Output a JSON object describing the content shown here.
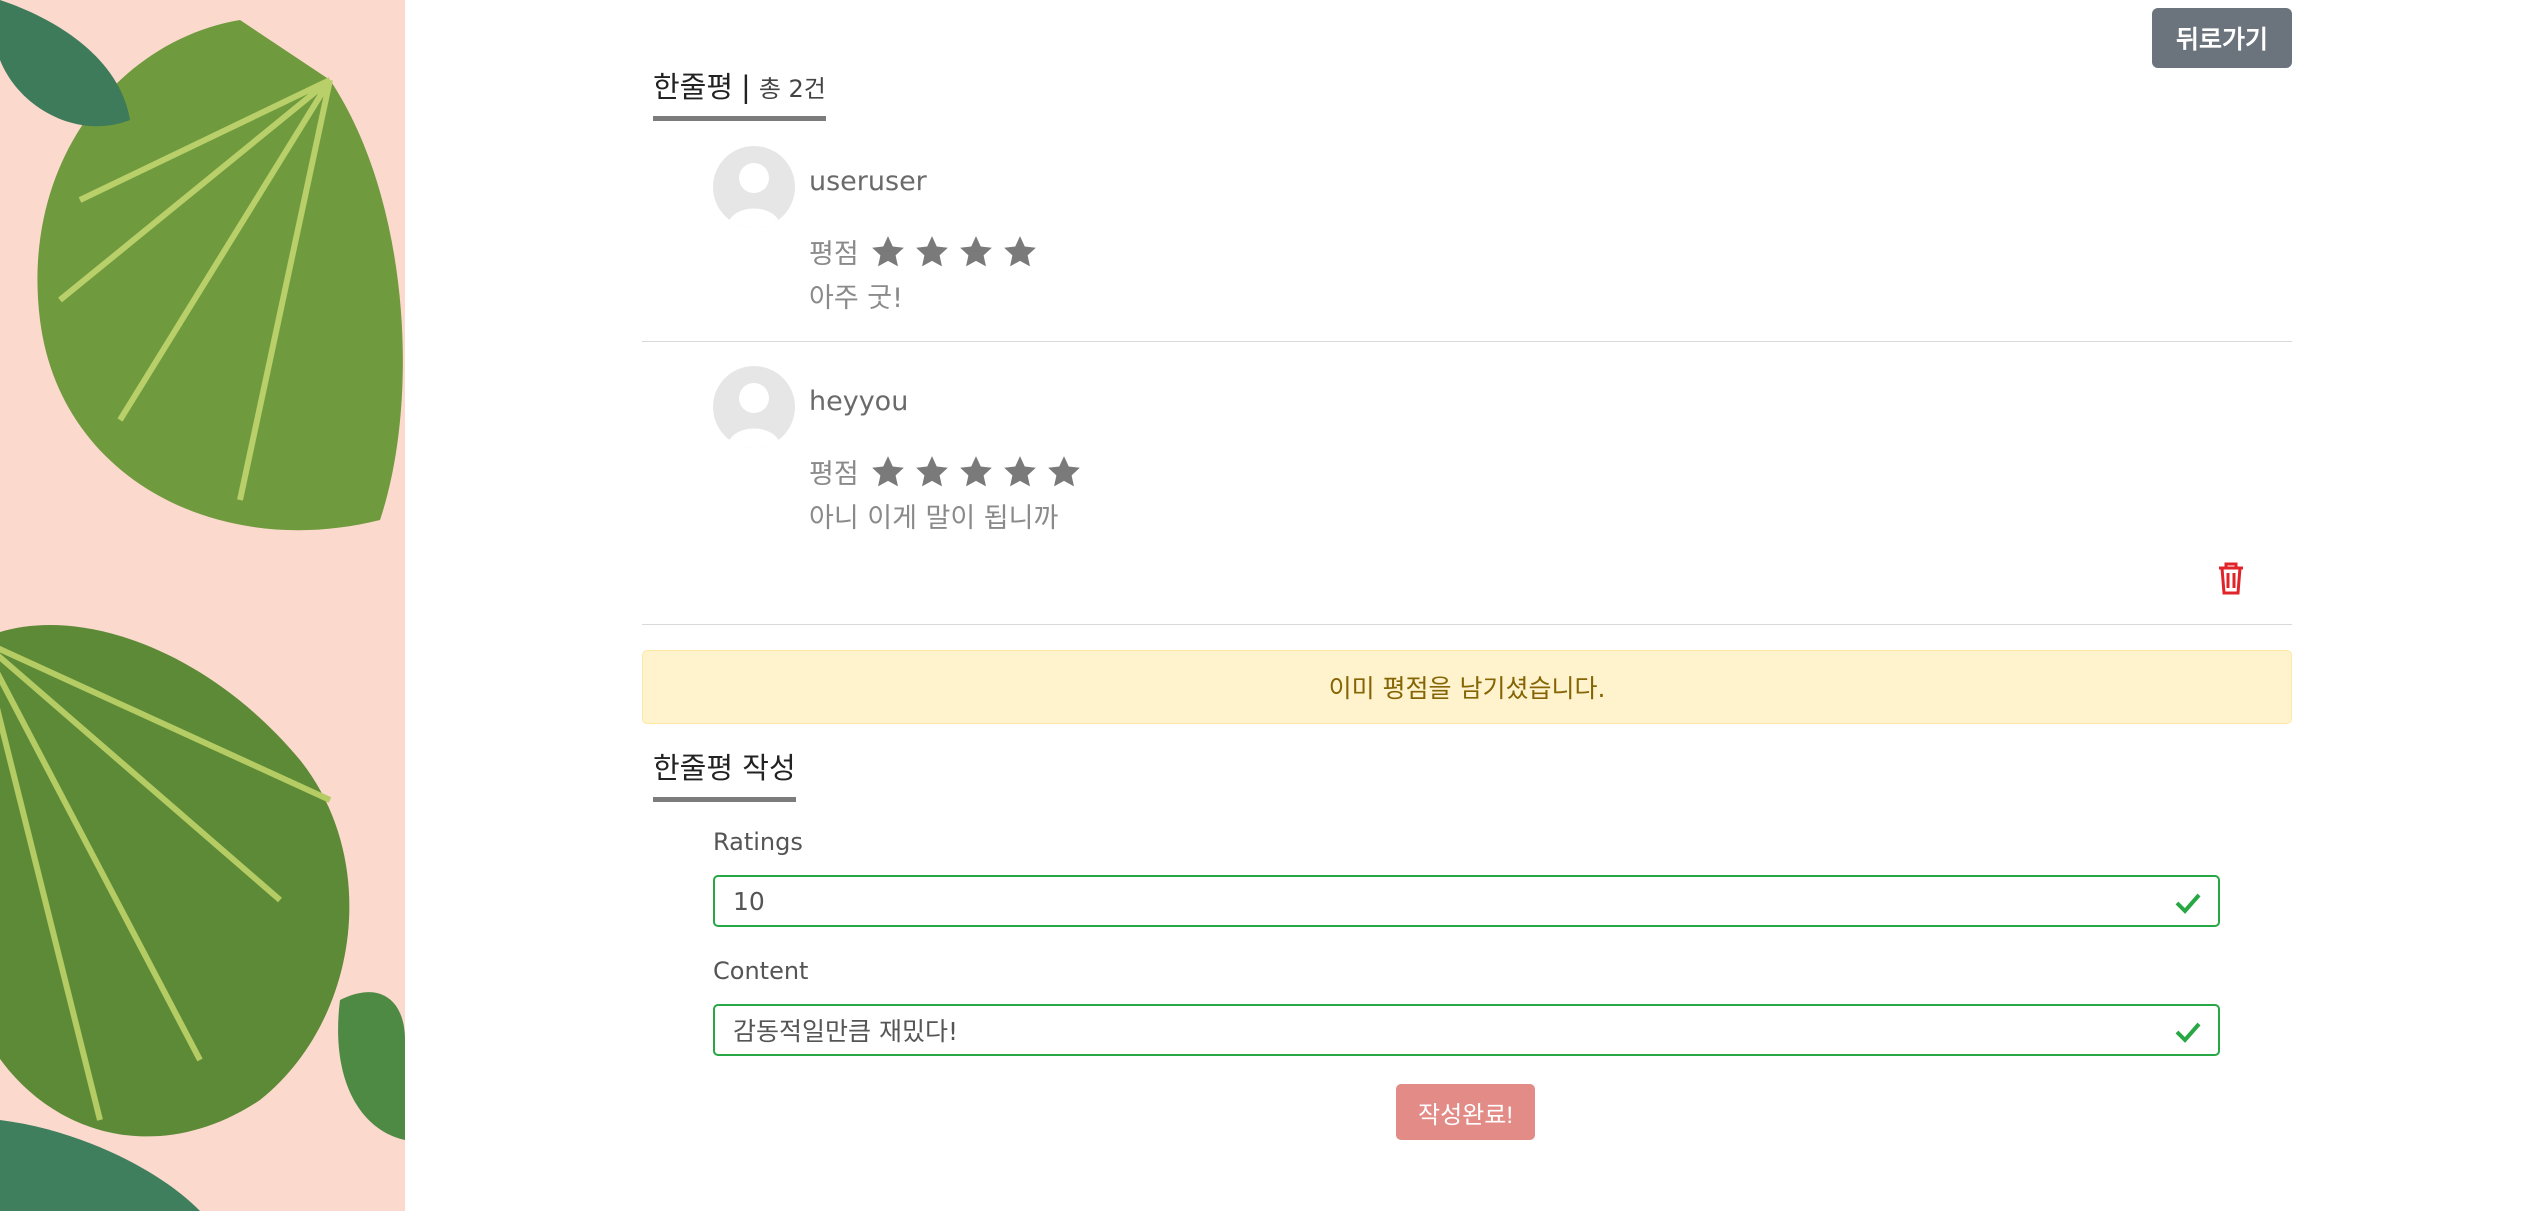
{
  "header": {
    "back_label": "뒤로가기"
  },
  "reviews_section": {
    "title": "한줄평",
    "separator": "|",
    "count_text": "총 2건"
  },
  "reviews": [
    {
      "username": "useruser",
      "rating_label": "평점",
      "stars": 4,
      "comment": "아주 굿!"
    },
    {
      "username": "heyyou",
      "rating_label": "평점",
      "stars": 5,
      "comment": "아니 이게 말이 됩니까"
    }
  ],
  "alert": {
    "message": "이미 평점을 남기셨습니다."
  },
  "form": {
    "title": "한줄평 작성",
    "ratings_label": "Ratings",
    "ratings_value": "10",
    "content_label": "Content",
    "content_value": "감동적일만큼 재밌다!",
    "submit_label": "작성완료!"
  },
  "colors": {
    "valid_border": "#28a745",
    "delete_icon": "#e0242a",
    "submit_bg": "#e28b87",
    "alert_bg": "#fff3cd",
    "star": "#7a7a7a"
  },
  "icons": [
    "avatar-placeholder-icon",
    "star-icon",
    "trash-icon",
    "checkmark-icon"
  ]
}
